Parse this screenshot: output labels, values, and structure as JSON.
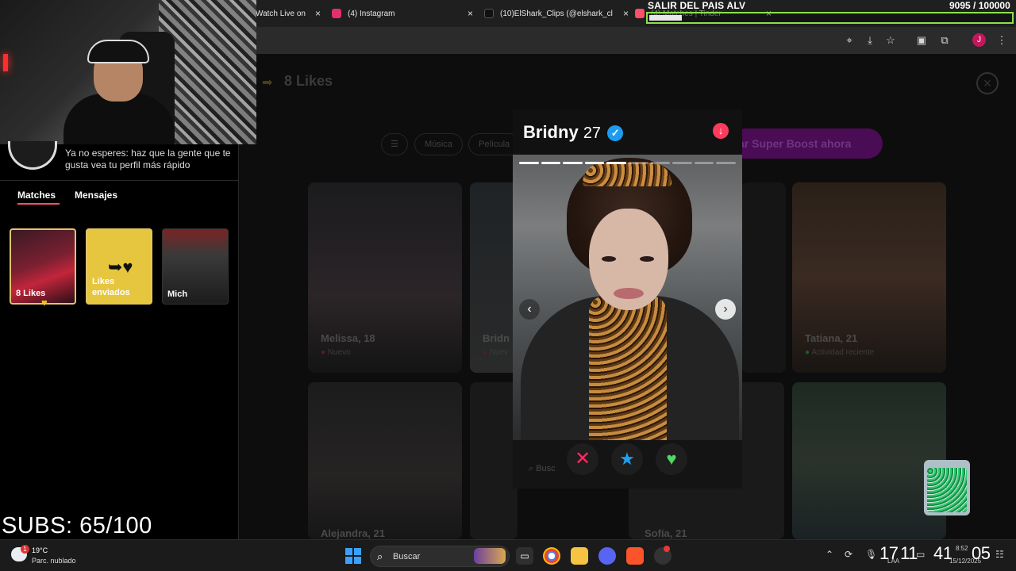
{
  "browser": {
    "tabs": [
      {
        "title": "Watch Live on",
        "close": "×",
        "color": "#9146ff"
      },
      {
        "title": "(4) Instagram",
        "close": "×",
        "color": "#e1306c"
      },
      {
        "title": "(10)ElShark_Clips (@elshark_cl",
        "close": "×",
        "color": "#000000"
      },
      {
        "title": "(4) Matches | Tinder",
        "close": "×",
        "color": "#fd5068"
      }
    ],
    "toolbar_icons": [
      "location-icon",
      "install-icon",
      "bookmark-star-icon",
      "screenshot-icon",
      "extensions-icon",
      "profile-avatar",
      "menu-kebab-icon"
    ],
    "profile_initial": "J"
  },
  "overlay": {
    "title": "SALIR DEL PAIS ALV",
    "count": "9095",
    "goal": "/ 100000",
    "progress_fraction": 0.09,
    "subs": "SUBS: 65/100"
  },
  "sidebar": {
    "boost_text": "Ya no esperes: haz que la gente que te gusta vea tu perfil más rápido",
    "tabs": [
      {
        "label": "Matches",
        "active": true
      },
      {
        "label": "Mensajes",
        "active": false
      }
    ],
    "cards": [
      {
        "label": "8 Likes"
      },
      {
        "label": "Likes enviados"
      },
      {
        "label": "Mich"
      }
    ]
  },
  "main": {
    "title": "8 Likes",
    "close_icon": "×",
    "chips": [
      "Música",
      "Película"
    ],
    "boost_button": "ar Super Boost ahora",
    "cards": [
      {
        "name": "Melissa, 18",
        "sub": "Nuevo",
        "sub_color": "red"
      },
      {
        "name": "Bridn",
        "sub": "Nuev",
        "sub_color": "red"
      },
      {
        "name": "Tatiana, 21",
        "sub": "Actividad reciente",
        "sub_color": "green"
      },
      {
        "name": "Alejandra, 21",
        "sub": "",
        "sub_color": ""
      },
      {
        "name": "Sofía, 21",
        "sub": "",
        "sub_color": ""
      }
    ]
  },
  "profile": {
    "name": "Bridny",
    "age": "27",
    "photo_count": 10,
    "photo_index": 4,
    "search_placeholder": "Busc",
    "actions": {
      "nope": "✕",
      "super": "★",
      "like": "♥"
    }
  },
  "taskbar": {
    "temp": "19°C",
    "weather": "Parc. nublado",
    "weather_badge": "1",
    "search_label": "Buscar",
    "clock_hours": "17",
    "clock_minutes": "11",
    "clock_seconds": "41",
    "clock_extra": "05",
    "time_small": "8:52",
    "date_small": "15/12/2025",
    "lang": "LAA"
  }
}
